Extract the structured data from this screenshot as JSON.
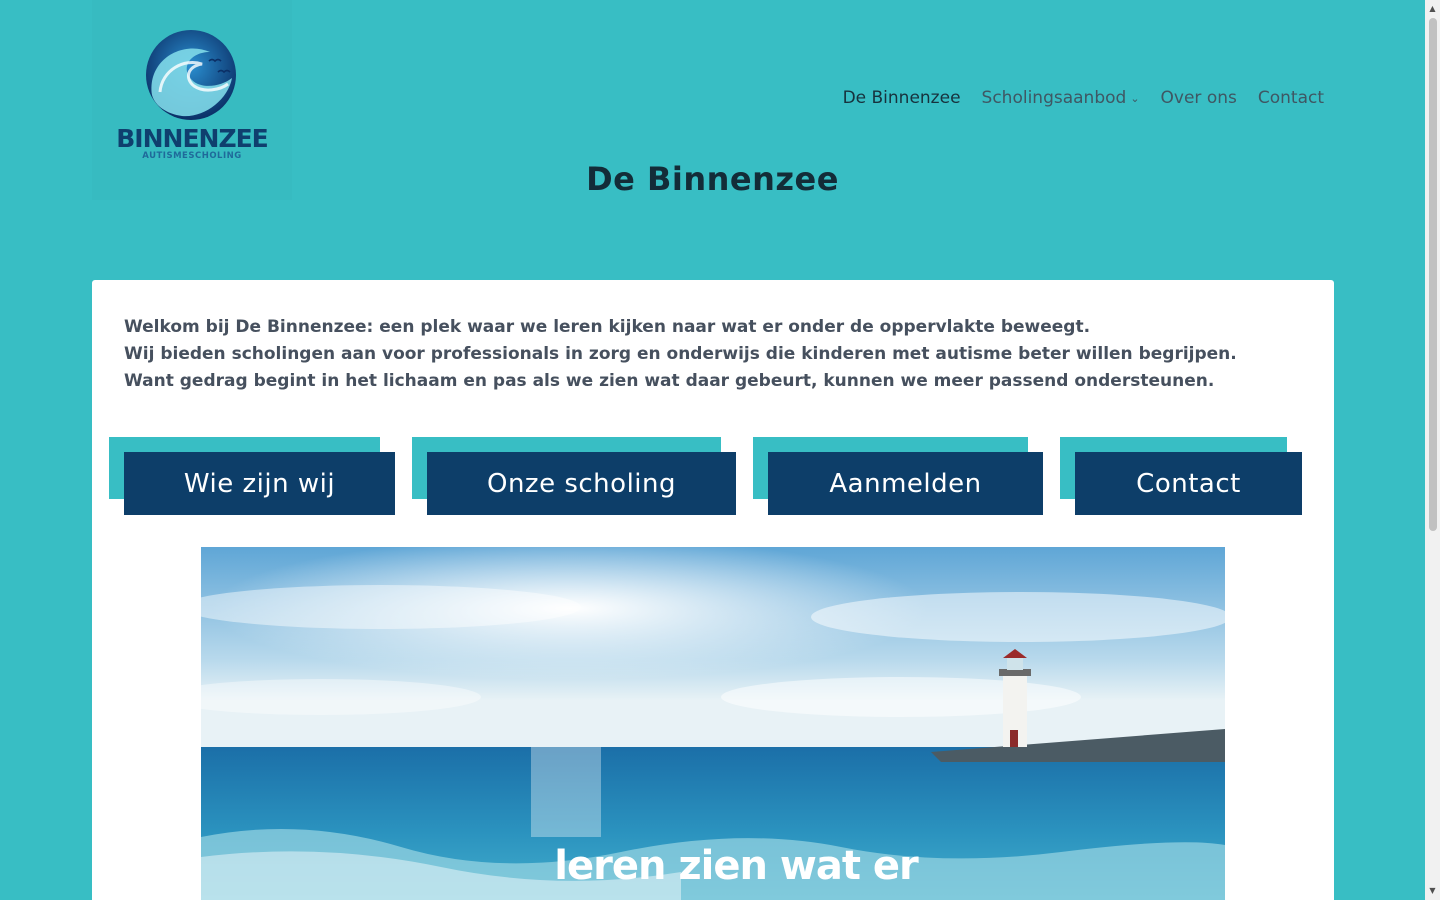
{
  "logo": {
    "name": "BINNENZEE",
    "subtitle": "AUTISMESCHOLING"
  },
  "nav": {
    "items": [
      {
        "label": "De Binnenzee"
      },
      {
        "label": "Scholingsaanbod"
      },
      {
        "label": "Over ons"
      },
      {
        "label": "Contact"
      }
    ]
  },
  "page": {
    "title": "De Binnenzee"
  },
  "intro": {
    "line1": "Welkom bij De Binnenzee: een plek waar we leren kijken naar wat er onder de oppervlakte beweegt.",
    "line2": "Wij bieden scholingen aan voor professionals in zorg en onderwijs die kinderen met autisme beter willen begrijpen.",
    "line3": "Want gedrag begint in het lichaam en pas als we zien wat daar gebeurt, kunnen we meer passend ondersteunen."
  },
  "buttons": {
    "who": "Wie zijn wij",
    "training": "Onze scholing",
    "register": "Aanmelden",
    "contact": "Contact"
  },
  "hero": {
    "caption": "leren zien wat er"
  },
  "colors": {
    "background": "#38bec4",
    "button": "#0d3e69",
    "card": "#ffffff"
  }
}
